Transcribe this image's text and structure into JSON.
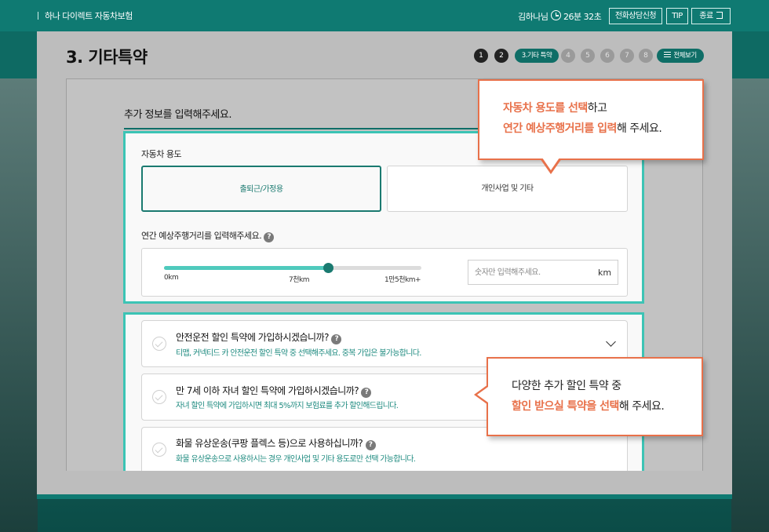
{
  "header": {
    "brand": "하나 다이렉트 자동차보험",
    "user": "김하나님",
    "timer": "26분 32초",
    "consult_label": "전화상담신청",
    "tip_label": "TIP",
    "exit_label": "종료"
  },
  "page": {
    "title": "3. 기타특약"
  },
  "steps": {
    "done": [
      "1",
      "2"
    ],
    "current": "3.기타 특약",
    "todo": [
      "4",
      "5",
      "6",
      "7",
      "8"
    ],
    "view_all": "전체보기"
  },
  "form": {
    "section_title": "추가 정보를 입력해주세요.",
    "usage": {
      "label": "자동차 용도",
      "options": [
        "출퇴근/가정용",
        "개인사업 및 기타"
      ],
      "selected": "출퇴근/가정용"
    },
    "distance": {
      "label": "연간 예상주행거리를 입력해주세요.",
      "help": "?",
      "ticks": [
        "0km",
        "7천km",
        "1만5천km+"
      ],
      "slider_fraction": 0.64,
      "placeholder": "숫자만 입력해주세요.",
      "unit": "km"
    }
  },
  "riders": [
    {
      "question": "안전운전 할인 특약에 가입하시겠습니까?",
      "desc": "티맵, 커넥티드 카 안전운전 할인 특약 중 선택해주세요. 중복 가입은 불가능합니다.",
      "help": "?"
    },
    {
      "question": "만 7세 이하 자녀 할인 특약에 가입하시겠습니까?",
      "desc": "자녀 할인 특약에 가입하시면 최대 5%까지 보험료를 추가 할인해드립니다.",
      "help": "?"
    },
    {
      "question": "화물 유상운송(쿠팡 플렉스 등)으로 사용하십니까?",
      "desc": "화물 유상운송으로 사용하시는 경우 개인사업 및 기타 용도로만 선택 가능합니다.",
      "help": "?"
    }
  ],
  "tooltips": {
    "tip1": {
      "line1_hl": "자동차 용도를 선택",
      "line1_rest": "하고",
      "line2_hl": "연간 예상주행거리를 입력",
      "line2_rest": "해 주세요."
    },
    "tip2": {
      "line1": "다양한 추가 할인 특약 중",
      "line2_hl": "할인 받으실 특약을 선택",
      "line2_rest": "해 주세요."
    }
  },
  "colors": {
    "brand_teal": "#0f7a72",
    "accent_mint": "#3cc4b5",
    "highlight_orange": "#e8714a"
  }
}
